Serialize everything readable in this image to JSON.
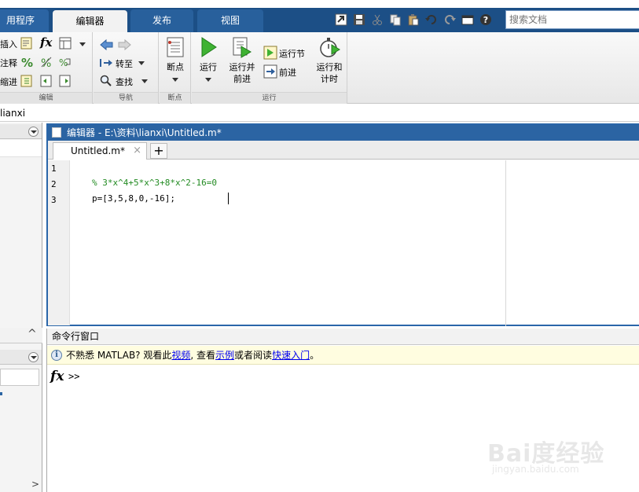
{
  "top_tabs": {
    "apps": "用程序",
    "editor": "编辑器",
    "publish": "发布",
    "view": "视图"
  },
  "quick_access": [
    "import-icon",
    "save-icon",
    "cut-icon",
    "copy-icon",
    "paste-icon",
    "undo-icon",
    "redo-icon",
    "switch-windows-icon",
    "help-icon"
  ],
  "search": {
    "placeholder": "搜索文档"
  },
  "ribbon": {
    "edit": {
      "insert": "插入",
      "comment": "注释",
      "indent": "缩进",
      "fx": "fx",
      "label": "编辑"
    },
    "navigate": {
      "goto": "转至",
      "find": "查找",
      "label": "导航"
    },
    "breakpoints": {
      "button": "断点",
      "label": "断点"
    },
    "run": {
      "run": "运行",
      "run_advance_1": "运行并",
      "run_advance_2": "前进",
      "run_section": "运行节",
      "advance": "前进",
      "run_time_1": "运行和",
      "run_time_2": "计时",
      "label": "运行"
    }
  },
  "path": {
    "text": "lianxi"
  },
  "editor": {
    "title": "编辑器 - E:\\资料\\lianxi\\Untitled.m*",
    "file_tab": "Untitled.m*",
    "close_symbol": "×",
    "new_tab_symbol": "+",
    "line_numbers": [
      "1",
      "2",
      "3"
    ],
    "lines": [
      "",
      "% 3*x^4+5*x^3+8*x^2-16=0",
      "p=[3,5,8,0,-16];"
    ]
  },
  "command_window": {
    "title": "命令行窗口",
    "hint_prefix": "不熟悉 MATLAB? 观看此",
    "hint_link_video": "视频",
    "hint_mid": ", 查看",
    "hint_link_examples": "示例",
    "hint_mid2": "或者阅读",
    "hint_link_getting_started": "快速入门",
    "hint_suffix": "。",
    "fx": "fx",
    "prompt": ">>"
  },
  "left_panel": {
    "collapse_symbol": "^",
    "scroll_symbol": ">"
  },
  "watermark": {
    "brand": "Bai度经验",
    "url": "jingyan.baidu.com"
  },
  "colors": {
    "title_blue": "#2b64a3",
    "tabbar": "#1c4f86",
    "comment_green": "#228b22",
    "hint_bg": "#fffde0"
  }
}
